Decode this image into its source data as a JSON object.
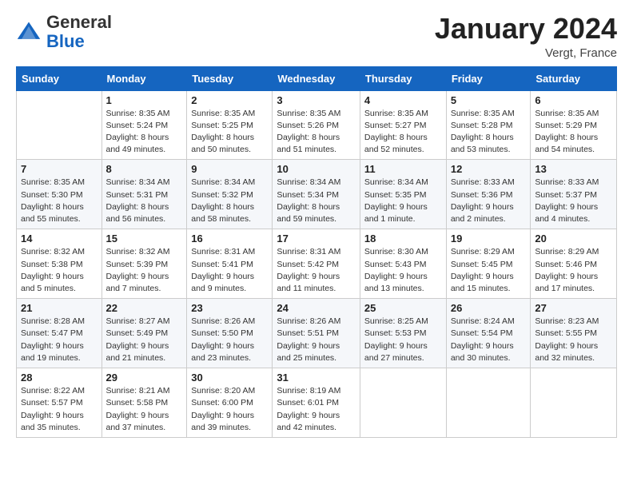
{
  "header": {
    "logo_general": "General",
    "logo_blue": "Blue",
    "month_title": "January 2024",
    "location": "Vergt, France"
  },
  "days_of_week": [
    "Sunday",
    "Monday",
    "Tuesday",
    "Wednesday",
    "Thursday",
    "Friday",
    "Saturday"
  ],
  "weeks": [
    [
      {
        "num": "",
        "sunrise": "",
        "sunset": "",
        "daylight": ""
      },
      {
        "num": "1",
        "sunrise": "Sunrise: 8:35 AM",
        "sunset": "Sunset: 5:24 PM",
        "daylight": "Daylight: 8 hours and 49 minutes."
      },
      {
        "num": "2",
        "sunrise": "Sunrise: 8:35 AM",
        "sunset": "Sunset: 5:25 PM",
        "daylight": "Daylight: 8 hours and 50 minutes."
      },
      {
        "num": "3",
        "sunrise": "Sunrise: 8:35 AM",
        "sunset": "Sunset: 5:26 PM",
        "daylight": "Daylight: 8 hours and 51 minutes."
      },
      {
        "num": "4",
        "sunrise": "Sunrise: 8:35 AM",
        "sunset": "Sunset: 5:27 PM",
        "daylight": "Daylight: 8 hours and 52 minutes."
      },
      {
        "num": "5",
        "sunrise": "Sunrise: 8:35 AM",
        "sunset": "Sunset: 5:28 PM",
        "daylight": "Daylight: 8 hours and 53 minutes."
      },
      {
        "num": "6",
        "sunrise": "Sunrise: 8:35 AM",
        "sunset": "Sunset: 5:29 PM",
        "daylight": "Daylight: 8 hours and 54 minutes."
      }
    ],
    [
      {
        "num": "7",
        "sunrise": "Sunrise: 8:35 AM",
        "sunset": "Sunset: 5:30 PM",
        "daylight": "Daylight: 8 hours and 55 minutes."
      },
      {
        "num": "8",
        "sunrise": "Sunrise: 8:34 AM",
        "sunset": "Sunset: 5:31 PM",
        "daylight": "Daylight: 8 hours and 56 minutes."
      },
      {
        "num": "9",
        "sunrise": "Sunrise: 8:34 AM",
        "sunset": "Sunset: 5:32 PM",
        "daylight": "Daylight: 8 hours and 58 minutes."
      },
      {
        "num": "10",
        "sunrise": "Sunrise: 8:34 AM",
        "sunset": "Sunset: 5:34 PM",
        "daylight": "Daylight: 8 hours and 59 minutes."
      },
      {
        "num": "11",
        "sunrise": "Sunrise: 8:34 AM",
        "sunset": "Sunset: 5:35 PM",
        "daylight": "Daylight: 9 hours and 1 minute."
      },
      {
        "num": "12",
        "sunrise": "Sunrise: 8:33 AM",
        "sunset": "Sunset: 5:36 PM",
        "daylight": "Daylight: 9 hours and 2 minutes."
      },
      {
        "num": "13",
        "sunrise": "Sunrise: 8:33 AM",
        "sunset": "Sunset: 5:37 PM",
        "daylight": "Daylight: 9 hours and 4 minutes."
      }
    ],
    [
      {
        "num": "14",
        "sunrise": "Sunrise: 8:32 AM",
        "sunset": "Sunset: 5:38 PM",
        "daylight": "Daylight: 9 hours and 5 minutes."
      },
      {
        "num": "15",
        "sunrise": "Sunrise: 8:32 AM",
        "sunset": "Sunset: 5:39 PM",
        "daylight": "Daylight: 9 hours and 7 minutes."
      },
      {
        "num": "16",
        "sunrise": "Sunrise: 8:31 AM",
        "sunset": "Sunset: 5:41 PM",
        "daylight": "Daylight: 9 hours and 9 minutes."
      },
      {
        "num": "17",
        "sunrise": "Sunrise: 8:31 AM",
        "sunset": "Sunset: 5:42 PM",
        "daylight": "Daylight: 9 hours and 11 minutes."
      },
      {
        "num": "18",
        "sunrise": "Sunrise: 8:30 AM",
        "sunset": "Sunset: 5:43 PM",
        "daylight": "Daylight: 9 hours and 13 minutes."
      },
      {
        "num": "19",
        "sunrise": "Sunrise: 8:29 AM",
        "sunset": "Sunset: 5:45 PM",
        "daylight": "Daylight: 9 hours and 15 minutes."
      },
      {
        "num": "20",
        "sunrise": "Sunrise: 8:29 AM",
        "sunset": "Sunset: 5:46 PM",
        "daylight": "Daylight: 9 hours and 17 minutes."
      }
    ],
    [
      {
        "num": "21",
        "sunrise": "Sunrise: 8:28 AM",
        "sunset": "Sunset: 5:47 PM",
        "daylight": "Daylight: 9 hours and 19 minutes."
      },
      {
        "num": "22",
        "sunrise": "Sunrise: 8:27 AM",
        "sunset": "Sunset: 5:49 PM",
        "daylight": "Daylight: 9 hours and 21 minutes."
      },
      {
        "num": "23",
        "sunrise": "Sunrise: 8:26 AM",
        "sunset": "Sunset: 5:50 PM",
        "daylight": "Daylight: 9 hours and 23 minutes."
      },
      {
        "num": "24",
        "sunrise": "Sunrise: 8:26 AM",
        "sunset": "Sunset: 5:51 PM",
        "daylight": "Daylight: 9 hours and 25 minutes."
      },
      {
        "num": "25",
        "sunrise": "Sunrise: 8:25 AM",
        "sunset": "Sunset: 5:53 PM",
        "daylight": "Daylight: 9 hours and 27 minutes."
      },
      {
        "num": "26",
        "sunrise": "Sunrise: 8:24 AM",
        "sunset": "Sunset: 5:54 PM",
        "daylight": "Daylight: 9 hours and 30 minutes."
      },
      {
        "num": "27",
        "sunrise": "Sunrise: 8:23 AM",
        "sunset": "Sunset: 5:55 PM",
        "daylight": "Daylight: 9 hours and 32 minutes."
      }
    ],
    [
      {
        "num": "28",
        "sunrise": "Sunrise: 8:22 AM",
        "sunset": "Sunset: 5:57 PM",
        "daylight": "Daylight: 9 hours and 35 minutes."
      },
      {
        "num": "29",
        "sunrise": "Sunrise: 8:21 AM",
        "sunset": "Sunset: 5:58 PM",
        "daylight": "Daylight: 9 hours and 37 minutes."
      },
      {
        "num": "30",
        "sunrise": "Sunrise: 8:20 AM",
        "sunset": "Sunset: 6:00 PM",
        "daylight": "Daylight: 9 hours and 39 minutes."
      },
      {
        "num": "31",
        "sunrise": "Sunrise: 8:19 AM",
        "sunset": "Sunset: 6:01 PM",
        "daylight": "Daylight: 9 hours and 42 minutes."
      },
      {
        "num": "",
        "sunrise": "",
        "sunset": "",
        "daylight": ""
      },
      {
        "num": "",
        "sunrise": "",
        "sunset": "",
        "daylight": ""
      },
      {
        "num": "",
        "sunrise": "",
        "sunset": "",
        "daylight": ""
      }
    ]
  ]
}
